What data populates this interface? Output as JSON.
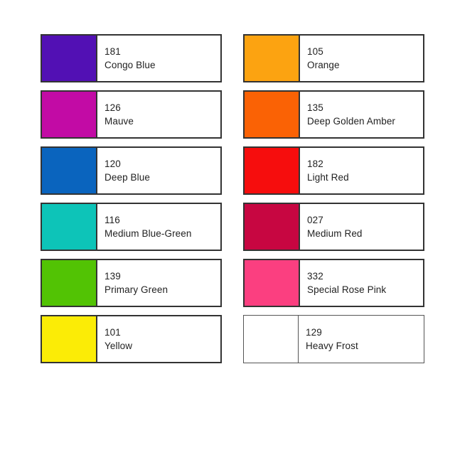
{
  "palette": {
    "background_color": "#ffffff",
    "border_color": "#333333",
    "text_color": "#222222",
    "columns": [
      {
        "name": "left-column",
        "swatches": [
          {
            "code": "181",
            "name": "Congo Blue",
            "color": "#5210B4",
            "clear": false
          },
          {
            "code": "126",
            "name": "Mauve",
            "color": "#C20BA5",
            "clear": false
          },
          {
            "code": "120",
            "name": "Deep Blue",
            "color": "#0A64BE",
            "clear": false
          },
          {
            "code": "116",
            "name": "Medium Blue-Green",
            "color": "#0DC4B8",
            "clear": false
          },
          {
            "code": "139",
            "name": "Primary Green",
            "color": "#52C304",
            "clear": false
          },
          {
            "code": "101",
            "name": "Yellow",
            "color": "#FBEC06",
            "clear": false
          }
        ]
      },
      {
        "name": "right-column",
        "swatches": [
          {
            "code": "105",
            "name": "Orange",
            "color": "#FCA311",
            "clear": false
          },
          {
            "code": "135",
            "name": "Deep Golden Amber",
            "color": "#FA6205",
            "clear": false
          },
          {
            "code": "182",
            "name": "Light Red",
            "color": "#F60D0D",
            "clear": false
          },
          {
            "code": "027",
            "name": "Medium Red",
            "color": "#C70641",
            "clear": false
          },
          {
            "code": "332",
            "name": "Special Rose Pink",
            "color": "#FB3F80",
            "clear": false
          },
          {
            "code": "129",
            "name": "Heavy Frost",
            "color": "#ffffff",
            "clear": true
          }
        ]
      }
    ]
  }
}
